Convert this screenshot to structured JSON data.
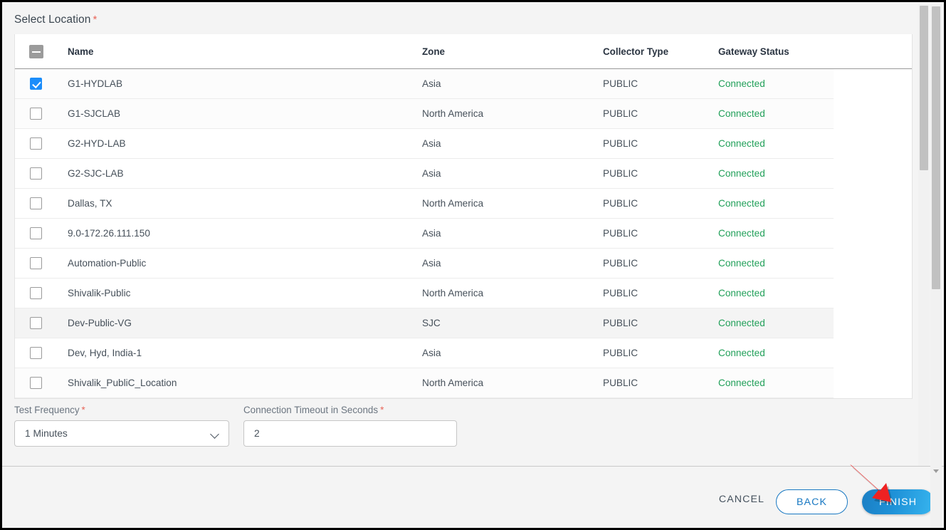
{
  "section": {
    "title": "Select Location",
    "required_marker": "*"
  },
  "table": {
    "columns": [
      {
        "key": "name",
        "label": "Name"
      },
      {
        "key": "zone",
        "label": "Zone"
      },
      {
        "key": "type",
        "label": "Collector Type"
      },
      {
        "key": "status",
        "label": "Gateway Status"
      }
    ],
    "select_all_state": "indeterminate",
    "status_color": "#22a05a",
    "checkbox_accent": "#1b8dfa",
    "rows": [
      {
        "checked": true,
        "name": "G1-HYDLAB",
        "zone": "Asia",
        "type": "PUBLIC",
        "status": "Connected",
        "highlight": "alt"
      },
      {
        "checked": false,
        "name": "G1-SJCLAB",
        "zone": "North America",
        "type": "PUBLIC",
        "status": "Connected",
        "highlight": "alt"
      },
      {
        "checked": false,
        "name": "G2-HYD-LAB",
        "zone": "Asia",
        "type": "PUBLIC",
        "status": "Connected",
        "highlight": "none"
      },
      {
        "checked": false,
        "name": "G2-SJC-LAB",
        "zone": "Asia",
        "type": "PUBLIC",
        "status": "Connected",
        "highlight": "none"
      },
      {
        "checked": false,
        "name": "Dallas, TX",
        "zone": "North America",
        "type": "PUBLIC",
        "status": "Connected",
        "highlight": "none"
      },
      {
        "checked": false,
        "name": "9.0-172.26.111.150",
        "zone": "Asia",
        "type": "PUBLIC",
        "status": "Connected",
        "highlight": "none"
      },
      {
        "checked": false,
        "name": "Automation-Public",
        "zone": "Asia",
        "type": "PUBLIC",
        "status": "Connected",
        "highlight": "none"
      },
      {
        "checked": false,
        "name": "Shivalik-Public",
        "zone": "North America",
        "type": "PUBLIC",
        "status": "Connected",
        "highlight": "none"
      },
      {
        "checked": false,
        "name": "Dev-Public-VG",
        "zone": "SJC",
        "type": "PUBLIC",
        "status": "Connected",
        "highlight": "hovered"
      },
      {
        "checked": false,
        "name": "Dev, Hyd, India-1",
        "zone": "Asia",
        "type": "PUBLIC",
        "status": "Connected",
        "highlight": "none"
      },
      {
        "checked": false,
        "name": "Shivalik_PubliC_Location",
        "zone": "North America",
        "type": "PUBLIC",
        "status": "Connected",
        "highlight": "alt"
      }
    ]
  },
  "form": {
    "test_frequency": {
      "label": "Test Frequency",
      "required_marker": "*",
      "value": "1 Minutes"
    },
    "connection_timeout": {
      "label": "Connection Timeout in Seconds",
      "required_marker": "*",
      "value": "2"
    }
  },
  "footer": {
    "cancel_label": "CANCEL",
    "back_label": "BACK",
    "finish_label": "FINISH",
    "finish_color": "#1f92d8",
    "back_color": "#1878c2"
  },
  "annotation": {
    "arrow_color": "#ee2222",
    "points_to": "FINISH"
  }
}
